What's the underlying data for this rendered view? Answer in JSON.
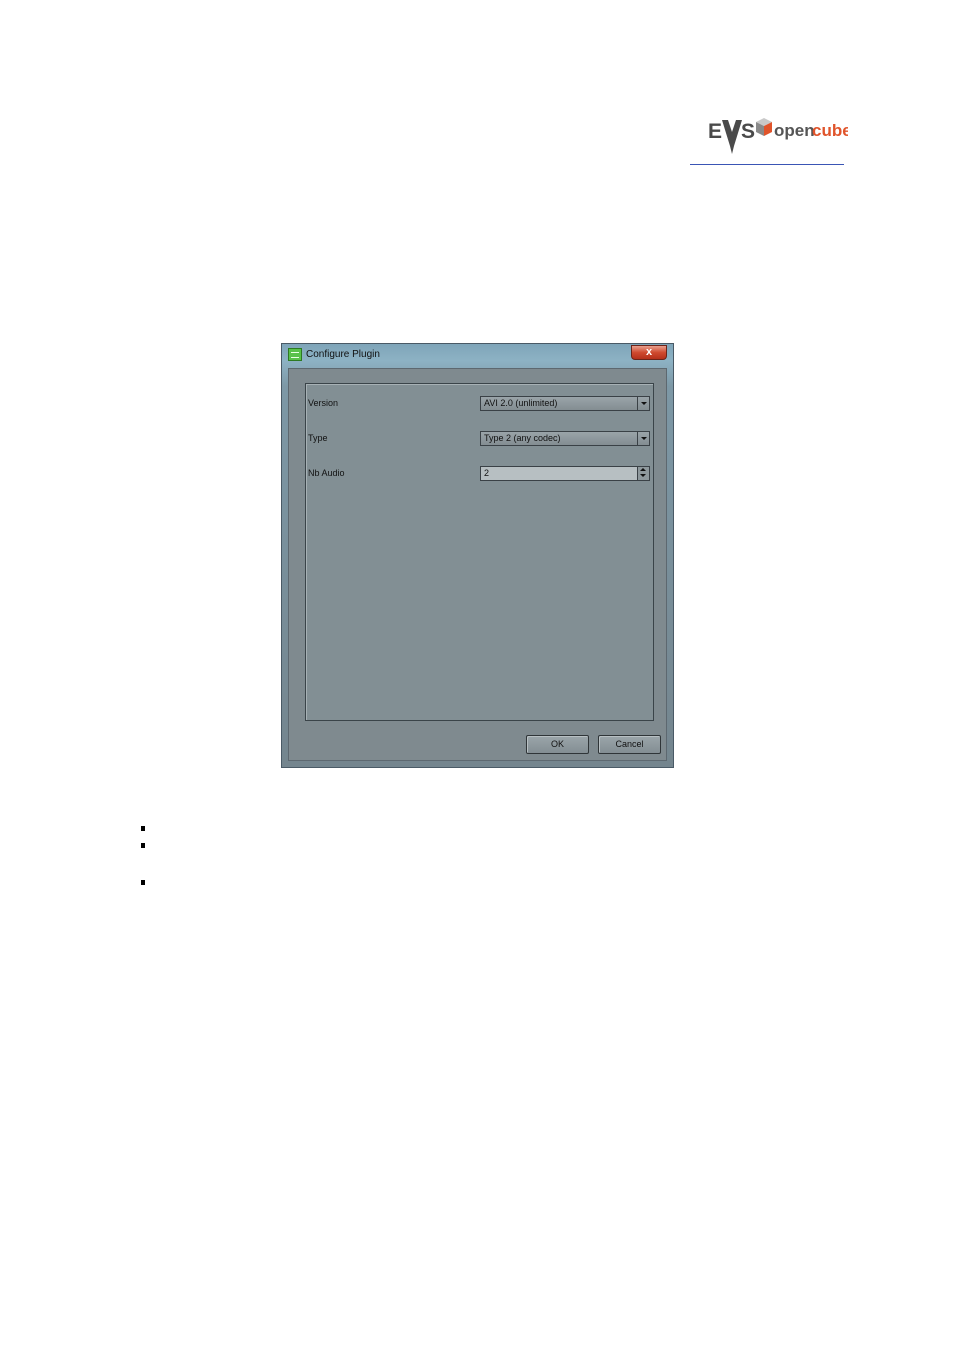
{
  "header": {
    "logo_text": "EVS openCube"
  },
  "dialog": {
    "title": "Configure Plugin",
    "close_glyph": "x",
    "fields": [
      {
        "label": "Version",
        "type": "combo",
        "value": "AVI 2.0 (unlimited)"
      },
      {
        "label": "Type",
        "type": "combo",
        "value": "Type 2 (any codec)"
      },
      {
        "label": "Nb Audio",
        "type": "spin",
        "value": "2"
      }
    ],
    "buttons": {
      "ok": "OK",
      "cancel": "Cancel"
    }
  },
  "bullet_count": 3
}
